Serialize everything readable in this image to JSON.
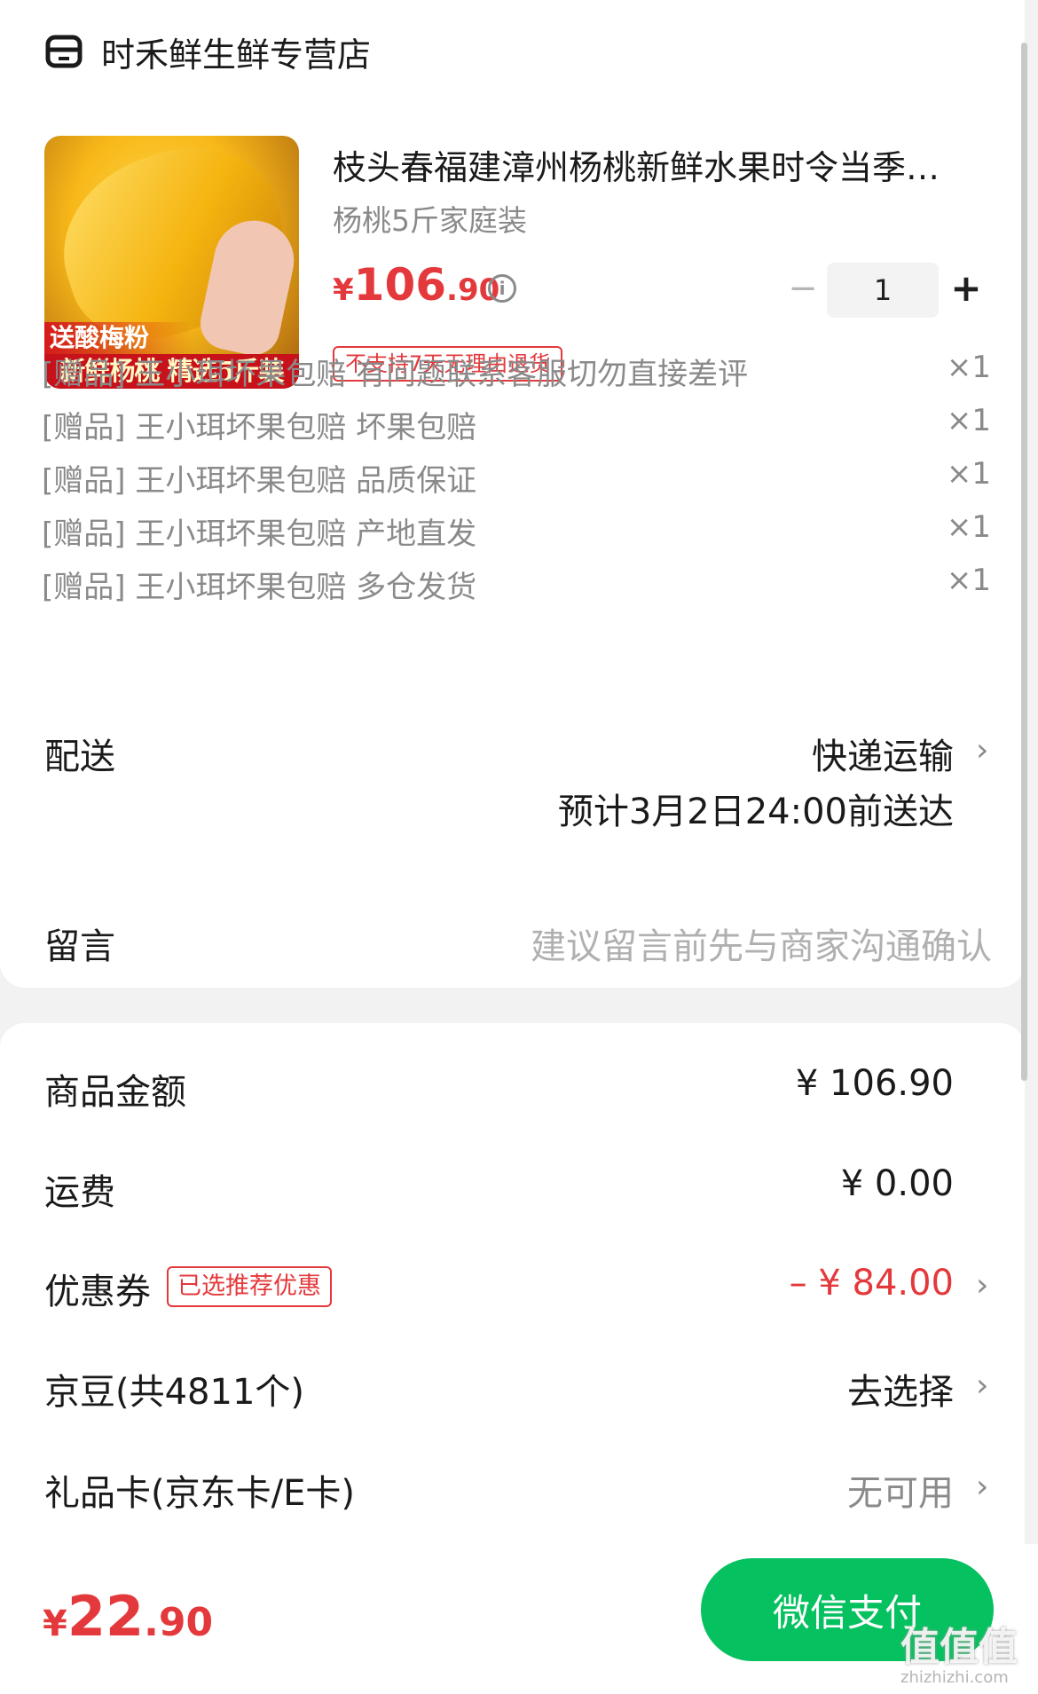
{
  "store": {
    "name": "时禾鲜生鲜专营店",
    "icon": "store-icon"
  },
  "product": {
    "title": "枝头春福建漳州杨桃新鲜水果时令当季整箱",
    "spec": "杨桃5斤家庭装",
    "price_currency": "¥",
    "price_int": "106",
    "price_dec": ".90",
    "return_policy": "不支持7天无理由退货",
    "quantity": "1",
    "image_banner_top": "送酸梅粉",
    "image_banner_bottom": "新鲜杨桃 精选5斤装"
  },
  "gifts": [
    {
      "text": "[赠品] 王小珥坏果包赔 有问题联系客服切勿直接差评",
      "qty": "×1"
    },
    {
      "text": "[赠品] 王小珥坏果包赔 坏果包赔",
      "qty": "×1"
    },
    {
      "text": "[赠品] 王小珥坏果包赔 品质保证",
      "qty": "×1"
    },
    {
      "text": "[赠品] 王小珥坏果包赔 产地直发",
      "qty": "×1"
    },
    {
      "text": "[赠品] 王小珥坏果包赔 多仓发货",
      "qty": "×1"
    }
  ],
  "delivery": {
    "label": "配送",
    "method": "快递运输",
    "eta": "预计3月2日24:00前送达"
  },
  "note": {
    "label": "留言",
    "placeholder": "建议留言前先与商家沟通确认"
  },
  "summary": {
    "goods_label": "商品金额",
    "goods_value": "¥ 106.90",
    "shipping_label": "运费",
    "shipping_value": "¥ 0.00",
    "coupon_label": "优惠券",
    "coupon_badge": "已选推荐优惠",
    "coupon_value": "– ¥ 84.00",
    "jd_beans_label": "京豆(共4811个)",
    "jd_beans_value": "去选择",
    "gift_card_label": "礼品卡(京东卡/E卡)",
    "gift_card_value": "无可用"
  },
  "total": {
    "currency": "¥",
    "int": "22",
    "dec": ".90"
  },
  "pay_button": "微信支付",
  "watermark": {
    "text": "值值值",
    "url": "zhizhizhi.com"
  },
  "colors": {
    "price_red": "#e4393c",
    "pay_green": "#05c15f",
    "gray_text": "#8a8a8a"
  }
}
